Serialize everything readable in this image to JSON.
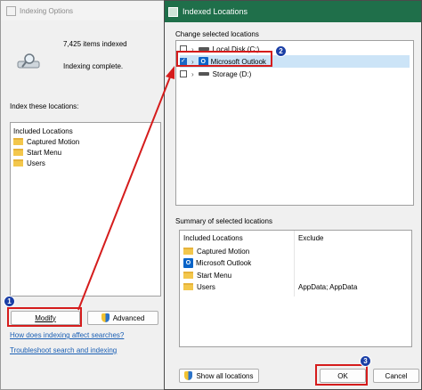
{
  "indexing_options": {
    "title": "Indexing Options",
    "items_indexed": "7,425 items indexed",
    "status": "Indexing complete.",
    "locations_label": "Index these locations:",
    "included_header": "Included Locations",
    "locations": [
      "Captured Motion",
      "Start Menu",
      "Users"
    ],
    "modify_label": "Modify",
    "advanced_label": "Advanced",
    "help_link": "How does indexing affect searches?",
    "troubleshoot_link": "Troubleshoot search and indexing"
  },
  "indexed_locations": {
    "title": "Indexed Locations",
    "change_label": "Change selected locations",
    "tree": [
      {
        "label": "Local Disk (C:)",
        "checked": false,
        "icon": "drive-icon"
      },
      {
        "label": "Microsoft Outlook",
        "checked": true,
        "icon": "outlook-icon"
      },
      {
        "label": "Storage (D:)",
        "checked": false,
        "icon": "drive-icon"
      }
    ],
    "summary_label": "Summary of selected locations",
    "summary_headers": [
      "Included Locations",
      "Exclude"
    ],
    "summary_rows": [
      {
        "location": "Captured Motion",
        "exclude": "",
        "icon": "folder-icon"
      },
      {
        "location": "Microsoft Outlook",
        "exclude": "",
        "icon": "outlook-icon"
      },
      {
        "location": "Start Menu",
        "exclude": "",
        "icon": "folder-icon"
      },
      {
        "location": "Users",
        "exclude": "AppData; AppData",
        "icon": "folder-icon"
      }
    ],
    "show_all_label": "Show all locations",
    "ok_label": "OK",
    "cancel_label": "Cancel"
  },
  "annotations": {
    "step1": "1",
    "step2": "2",
    "step3": "3"
  },
  "colors": {
    "highlight_red": "#d51c1c",
    "title_green": "#1f6f4a",
    "badge_blue": "#1b3fa6"
  }
}
